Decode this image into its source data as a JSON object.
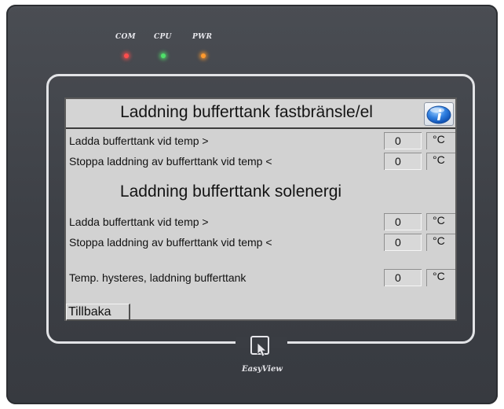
{
  "leds": [
    {
      "label": "COM",
      "color": "#ff4d4d"
    },
    {
      "label": "CPU",
      "color": "#4fe06a"
    },
    {
      "label": "PWR",
      "color": "#ff9a2e"
    }
  ],
  "screen": {
    "title": "Laddning bufferttank fastbränsle/el",
    "info_icon": "info-icon",
    "section1": {
      "rows": [
        {
          "label": "Ladda bufferttank vid temp >",
          "value": "0",
          "unit": "°C"
        },
        {
          "label": "Stoppa laddning av bufferttank vid temp <",
          "value": "0",
          "unit": "°C"
        }
      ]
    },
    "section2": {
      "title": "Laddning bufferttank solenergi",
      "rows": [
        {
          "label": "Ladda bufferttank vid temp >",
          "value": "0",
          "unit": "°C"
        },
        {
          "label": "Stoppa laddning av bufferttank vid temp <",
          "value": "0",
          "unit": "°C"
        }
      ]
    },
    "hysteresis": {
      "label": "Temp. hysteres, laddning bufferttank",
      "value": "0",
      "unit": "°C"
    },
    "back_label": "Tillbaka"
  },
  "brand": {
    "name": "EasyView",
    "logo_icon": "easyview-logo-icon"
  }
}
